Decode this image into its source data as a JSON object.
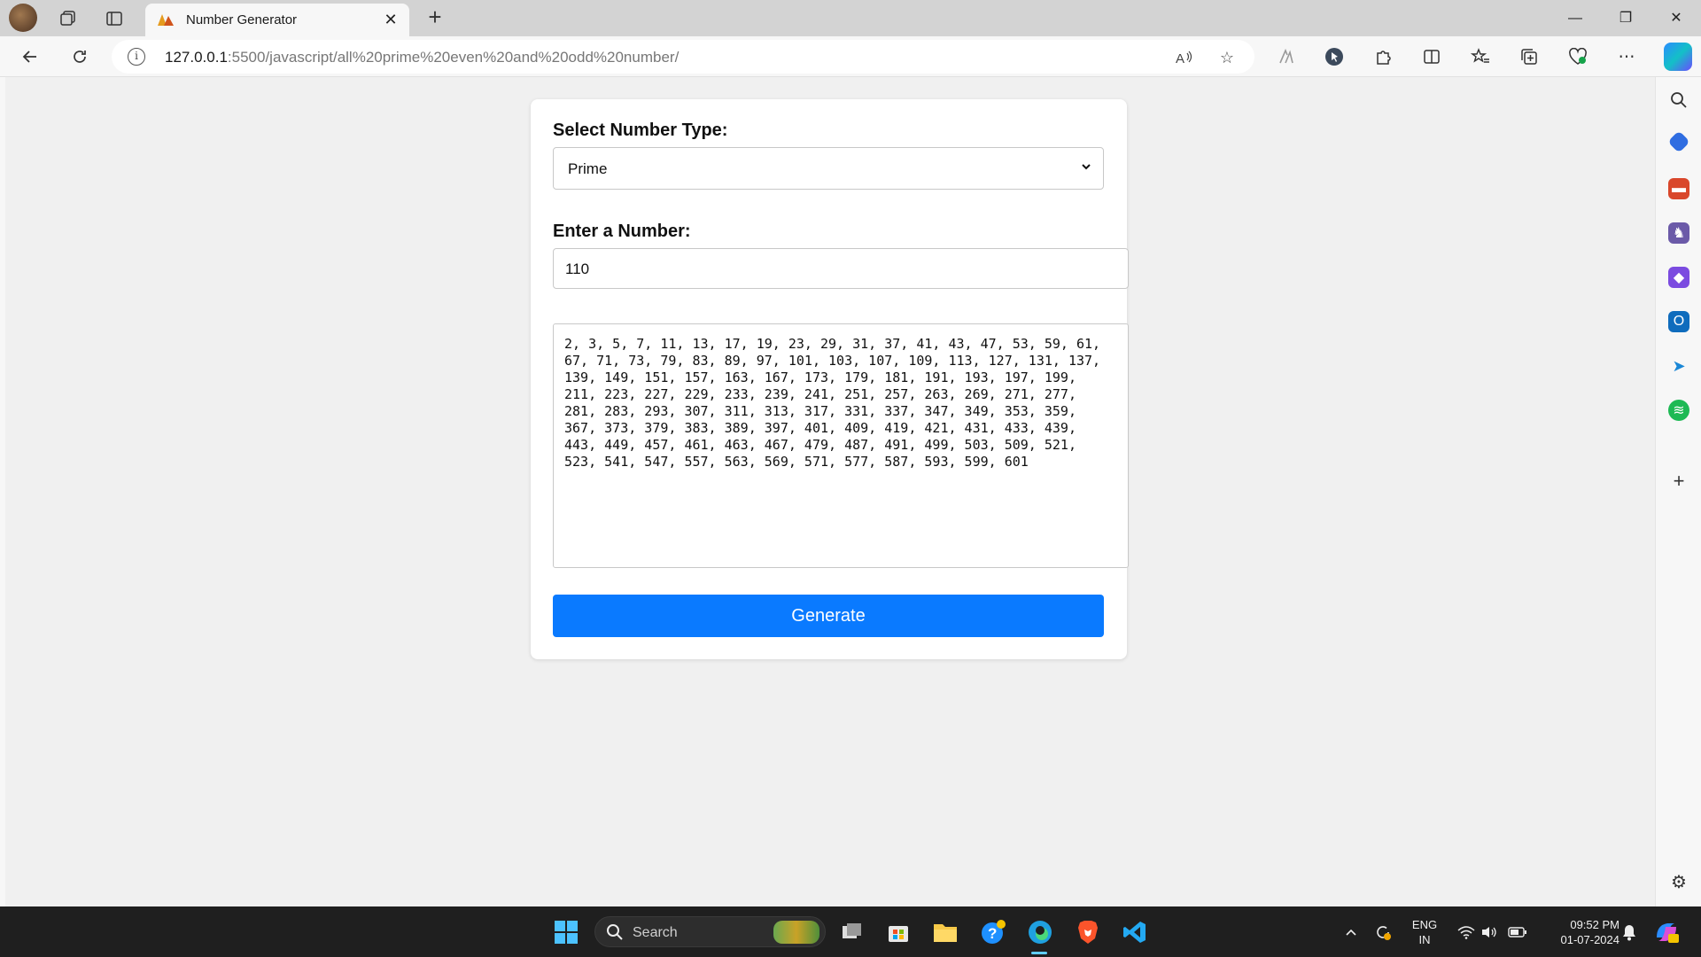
{
  "browser": {
    "tab_title": "Number Generator",
    "url_host": "127.0.0.1",
    "url_rest": ":5500/javascript/all%20prime%20even%20and%20odd%20number/"
  },
  "page": {
    "select_label": "Select Number Type:",
    "select_value": "Prime",
    "number_label": "Enter a Number:",
    "number_value": "110",
    "output": "2, 3, 5, 7, 11, 13, 17, 19, 23, 29, 31, 37, 41, 43, 47, 53, 59, 61,\n67, 71, 73, 79, 83, 89, 97, 101, 103, 107, 109, 113, 127, 131, 137,\n139, 149, 151, 157, 163, 167, 173, 179, 181, 191, 193, 197, 199,\n211, 223, 227, 229, 233, 239, 241, 251, 257, 263, 269, 271, 277,\n281, 283, 293, 307, 311, 313, 317, 331, 337, 347, 349, 353, 359,\n367, 373, 379, 383, 389, 397, 401, 409, 419, 421, 431, 433, 439,\n443, 449, 457, 461, 463, 467, 479, 487, 491, 499, 503, 509, 521,\n523, 541, 547, 557, 563, 569, 571, 577, 587, 593, 599, 601",
    "button_label": "Generate",
    "accent_color": "#0a7aff"
  },
  "taskbar": {
    "search_placeholder": "Search",
    "lang_primary": "ENG",
    "lang_secondary": "IN",
    "time": "09:52 PM",
    "date": "01-07-2024"
  }
}
